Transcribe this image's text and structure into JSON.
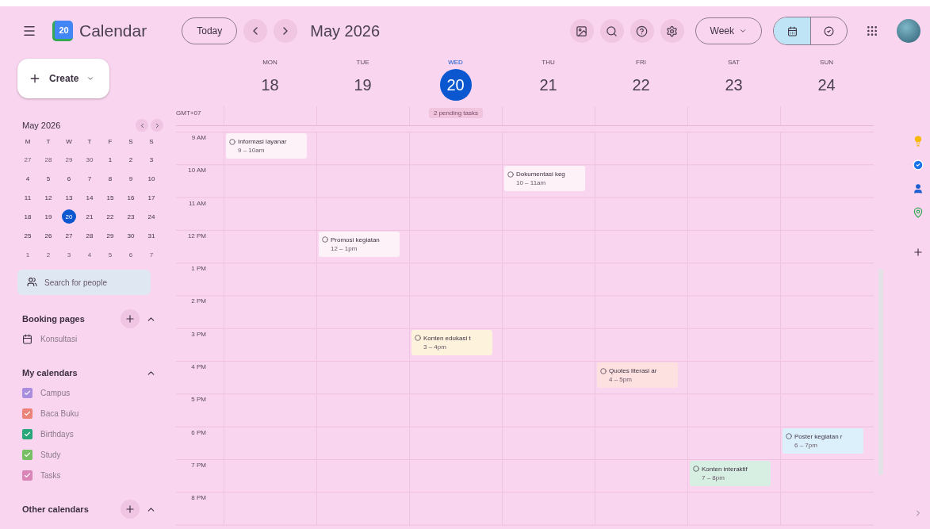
{
  "header": {
    "app_name": "Calendar",
    "logo_text": "20",
    "today_button": "Today",
    "period": "May 2026",
    "view_select": "Week",
    "view_toggle": [
      {
        "kind": "calendar",
        "selected": true
      },
      {
        "kind": "tasks",
        "selected": false
      }
    ]
  },
  "sidebar": {
    "create_button": "Create",
    "mini_calendar": {
      "title": "May 2026",
      "weekdays": [
        "M",
        "T",
        "W",
        "T",
        "F",
        "S",
        "S"
      ],
      "weeks": [
        [
          {
            "day": "27",
            "muted": true,
            "selected": false
          },
          {
            "day": "28",
            "muted": true,
            "selected": false
          },
          {
            "day": "29",
            "muted": true,
            "selected": false
          },
          {
            "day": "30",
            "muted": true,
            "selected": false
          },
          {
            "day": "1",
            "muted": false,
            "selected": false
          },
          {
            "day": "2",
            "muted": false,
            "selected": false
          },
          {
            "day": "3",
            "muted": false,
            "selected": false
          }
        ],
        [
          {
            "day": "4",
            "muted": false,
            "selected": false
          },
          {
            "day": "5",
            "muted": false,
            "selected": false
          },
          {
            "day": "6",
            "muted": false,
            "selected": false
          },
          {
            "day": "7",
            "muted": false,
            "selected": false
          },
          {
            "day": "8",
            "muted": false,
            "selected": false
          },
          {
            "day": "9",
            "muted": false,
            "selected": false
          },
          {
            "day": "10",
            "muted": false,
            "selected": false
          }
        ],
        [
          {
            "day": "11",
            "muted": false,
            "selected": false
          },
          {
            "day": "12",
            "muted": false,
            "selected": false
          },
          {
            "day": "13",
            "muted": false,
            "selected": false
          },
          {
            "day": "14",
            "muted": false,
            "selected": false
          },
          {
            "day": "15",
            "muted": false,
            "selected": false
          },
          {
            "day": "16",
            "muted": false,
            "selected": false
          },
          {
            "day": "17",
            "muted": false,
            "selected": false
          }
        ],
        [
          {
            "day": "18",
            "muted": false,
            "selected": false
          },
          {
            "day": "19",
            "muted": false,
            "selected": false
          },
          {
            "day": "20",
            "muted": false,
            "selected": true
          },
          {
            "day": "21",
            "muted": false,
            "selected": false
          },
          {
            "day": "22",
            "muted": false,
            "selected": false
          },
          {
            "day": "23",
            "muted": false,
            "selected": false
          },
          {
            "day": "24",
            "muted": false,
            "selected": false
          }
        ],
        [
          {
            "day": "25",
            "muted": false,
            "selected": false
          },
          {
            "day": "26",
            "muted": false,
            "selected": false
          },
          {
            "day": "27",
            "muted": false,
            "selected": false
          },
          {
            "day": "28",
            "muted": false,
            "selected": false
          },
          {
            "day": "29",
            "muted": false,
            "selected": false
          },
          {
            "day": "30",
            "muted": false,
            "selected": false
          },
          {
            "day": "31",
            "muted": false,
            "selected": false
          }
        ],
        [
          {
            "day": "1",
            "muted": true,
            "selected": false
          },
          {
            "day": "2",
            "muted": true,
            "selected": false
          },
          {
            "day": "3",
            "muted": true,
            "selected": false
          },
          {
            "day": "4",
            "muted": true,
            "selected": false
          },
          {
            "day": "5",
            "muted": true,
            "selected": false
          },
          {
            "day": "6",
            "muted": true,
            "selected": false
          },
          {
            "day": "7",
            "muted": true,
            "selected": false
          }
        ]
      ]
    },
    "search_people": {
      "placeholder": "Search for people"
    },
    "booking_pages": {
      "title": "Booking pages",
      "expanded": true,
      "items": [
        "Konsultasi"
      ]
    },
    "my_calendars": {
      "title": "My calendars",
      "expanded": true,
      "items": [
        {
          "name": "Campus",
          "color": "#a98ee0",
          "checked": true
        },
        {
          "name": "Baca Buku",
          "color": "#ec8378",
          "checked": true
        },
        {
          "name": "Birthdays",
          "color": "#27a77a",
          "checked": true
        },
        {
          "name": "Study",
          "color": "#77bf64",
          "checked": true
        },
        {
          "name": "Tasks",
          "color": "#d985b8",
          "checked": true
        }
      ]
    },
    "other_calendars": {
      "title": "Other calendars",
      "expanded": true
    }
  },
  "week": {
    "timezone": "GMT+07",
    "days": [
      {
        "name": "MON",
        "date": "18",
        "selected": false
      },
      {
        "name": "TUE",
        "date": "19",
        "selected": false
      },
      {
        "name": "WED",
        "date": "20",
        "selected": true,
        "tasks_chip": "2 pending tasks"
      },
      {
        "name": "THU",
        "date": "21",
        "selected": false
      },
      {
        "name": "FRI",
        "date": "22",
        "selected": false
      },
      {
        "name": "SAT",
        "date": "23",
        "selected": false
      },
      {
        "name": "SUN",
        "date": "24",
        "selected": false
      }
    ],
    "rows": [
      {
        "hour": "9 AM",
        "cells": [
          {
            "kind": "event",
            "title": "Informasi layanar",
            "time": "9 – 10am",
            "color": "#fdf2f8"
          },
          {
            "kind": "empty"
          },
          {
            "kind": "empty"
          },
          {
            "kind": "empty"
          },
          {
            "kind": "empty"
          },
          {
            "kind": "empty"
          },
          {
            "kind": "empty"
          }
        ]
      },
      {
        "hour": "10 AM",
        "cells": [
          {
            "kind": "empty"
          },
          {
            "kind": "empty"
          },
          {
            "kind": "empty"
          },
          {
            "kind": "event",
            "title": "Dokumentasi keg",
            "time": "10 – 11am",
            "color": "#fdf2f8"
          },
          {
            "kind": "empty"
          },
          {
            "kind": "empty"
          },
          {
            "kind": "empty"
          }
        ]
      },
      {
        "hour": "11 AM",
        "cells": [
          {
            "kind": "empty"
          },
          {
            "kind": "empty"
          },
          {
            "kind": "empty"
          },
          {
            "kind": "empty"
          },
          {
            "kind": "empty"
          },
          {
            "kind": "empty"
          },
          {
            "kind": "empty"
          }
        ]
      },
      {
        "hour": "12 PM",
        "cells": [
          {
            "kind": "empty"
          },
          {
            "kind": "event",
            "title": "Promosi kegiatan",
            "time": "12 – 1pm",
            "color": "#fdf2f8"
          },
          {
            "kind": "empty"
          },
          {
            "kind": "empty"
          },
          {
            "kind": "empty"
          },
          {
            "kind": "empty"
          },
          {
            "kind": "empty"
          }
        ]
      },
      {
        "hour": "1 PM",
        "cells": [
          {
            "kind": "empty"
          },
          {
            "kind": "empty"
          },
          {
            "kind": "empty"
          },
          {
            "kind": "empty"
          },
          {
            "kind": "empty"
          },
          {
            "kind": "empty"
          },
          {
            "kind": "empty"
          }
        ]
      },
      {
        "hour": "2 PM",
        "cells": [
          {
            "kind": "empty"
          },
          {
            "kind": "empty"
          },
          {
            "kind": "empty"
          },
          {
            "kind": "empty"
          },
          {
            "kind": "empty"
          },
          {
            "kind": "empty"
          },
          {
            "kind": "empty"
          }
        ]
      },
      {
        "hour": "3 PM",
        "cells": [
          {
            "kind": "empty"
          },
          {
            "kind": "empty"
          },
          {
            "kind": "event",
            "title": "Konten edukasi t",
            "time": "3 – 4pm",
            "color": "#fdf3dc"
          },
          {
            "kind": "empty"
          },
          {
            "kind": "empty"
          },
          {
            "kind": "empty"
          },
          {
            "kind": "empty"
          }
        ]
      },
      {
        "hour": "4 PM",
        "cells": [
          {
            "kind": "empty"
          },
          {
            "kind": "empty"
          },
          {
            "kind": "empty"
          },
          {
            "kind": "empty"
          },
          {
            "kind": "event",
            "title": "Quotes literasi ar",
            "time": "4 – 5pm",
            "color": "#fde0e0"
          },
          {
            "kind": "empty"
          },
          {
            "kind": "empty"
          }
        ]
      },
      {
        "hour": "5 PM",
        "cells": [
          {
            "kind": "empty"
          },
          {
            "kind": "empty"
          },
          {
            "kind": "empty"
          },
          {
            "kind": "empty"
          },
          {
            "kind": "empty"
          },
          {
            "kind": "empty"
          },
          {
            "kind": "empty"
          }
        ]
      },
      {
        "hour": "6 PM",
        "cells": [
          {
            "kind": "empty"
          },
          {
            "kind": "empty"
          },
          {
            "kind": "empty"
          },
          {
            "kind": "empty"
          },
          {
            "kind": "empty"
          },
          {
            "kind": "empty"
          },
          {
            "kind": "event",
            "title": "Poster kegiatan r",
            "time": "6 – 7pm",
            "color": "#dcf0fb"
          }
        ]
      },
      {
        "hour": "7 PM",
        "cells": [
          {
            "kind": "empty"
          },
          {
            "kind": "empty"
          },
          {
            "kind": "empty"
          },
          {
            "kind": "empty"
          },
          {
            "kind": "empty"
          },
          {
            "kind": "event",
            "title": "Konten interaktif",
            "time": "7 – 8pm",
            "color": "#d7efe3"
          },
          {
            "kind": "empty"
          }
        ]
      },
      {
        "hour": "8 PM",
        "cells": [
          {
            "kind": "empty"
          },
          {
            "kind": "empty"
          },
          {
            "kind": "empty"
          },
          {
            "kind": "empty"
          },
          {
            "kind": "empty"
          },
          {
            "kind": "empty"
          },
          {
            "kind": "empty"
          }
        ]
      }
    ]
  },
  "side_panel": {
    "apps": [
      {
        "kind": "keep"
      },
      {
        "kind": "tasks"
      },
      {
        "kind": "contacts"
      },
      {
        "kind": "maps"
      }
    ]
  }
}
